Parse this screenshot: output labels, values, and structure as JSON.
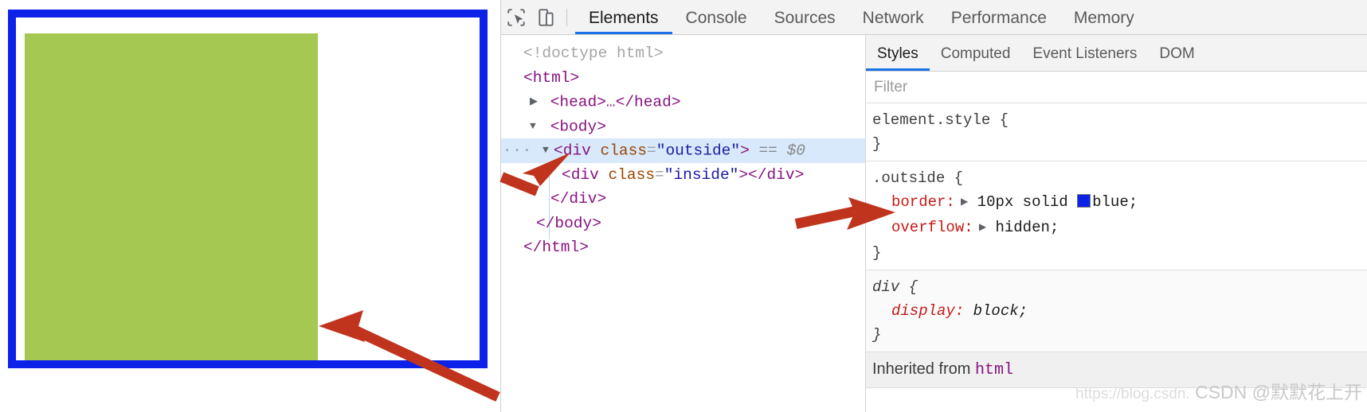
{
  "viewport": {
    "outside_box": {
      "name": "outside",
      "border_color": "#0d22e8",
      "border_width": "10px",
      "background": "#ffffff"
    },
    "inside_box": {
      "name": "inside",
      "background": "#a4c851"
    },
    "annotations": [
      {
        "name": "arrow-to-bottom-border",
        "color": "#c0341d"
      }
    ]
  },
  "devtools": {
    "toolbar": {
      "icons": [
        {
          "name": "inspect-element-icon",
          "glyph": "cursor-in-box"
        },
        {
          "name": "device-toolbar-icon",
          "glyph": "device-frame"
        }
      ],
      "tabs": [
        {
          "label": "Elements",
          "active": true
        },
        {
          "label": "Console",
          "active": false
        },
        {
          "label": "Sources",
          "active": false
        },
        {
          "label": "Network",
          "active": false
        },
        {
          "label": "Performance",
          "active": false
        },
        {
          "label": "Memory",
          "active": false
        }
      ]
    },
    "dom_tree": {
      "lines": [
        {
          "id": "doctype",
          "text": "<!doctype html>"
        },
        {
          "id": "html_open",
          "text": "<html>"
        },
        {
          "id": "head",
          "text": "<head>…</head>"
        },
        {
          "id": "body_open",
          "text": "<body>"
        },
        {
          "id": "div_outside",
          "tag": "div",
          "attr": "class",
          "value": "outside",
          "suffix": "== $0"
        },
        {
          "id": "div_inside",
          "tag": "div",
          "attr": "class",
          "value": "inside"
        },
        {
          "id": "div_close",
          "text": "</div>"
        },
        {
          "id": "body_close",
          "text": "</body>"
        },
        {
          "id": "html_close",
          "text": "</html>"
        }
      ],
      "selected_line": "div_outside",
      "ellipsis_badge": "···"
    },
    "styles": {
      "tabs": [
        {
          "label": "Styles",
          "active": true
        },
        {
          "label": "Computed",
          "active": false
        },
        {
          "label": "Event Listeners",
          "active": false
        },
        {
          "label": "DOM",
          "active": false
        }
      ],
      "filter_placeholder": "Filter",
      "filter_value": "",
      "rules": [
        {
          "selector": "element.style {",
          "close": "}",
          "declarations": []
        },
        {
          "selector": ".outside {",
          "close": "}",
          "declarations": [
            {
              "property": "border:",
              "value": "10px solid",
              "color_swatch": "#0d22e8",
              "color_name": "blue;",
              "expandable": true
            },
            {
              "property": "overflow:",
              "value": "hidden;",
              "expandable": true
            }
          ]
        },
        {
          "selector": "div {",
          "close": "}",
          "inherited_style": true,
          "declarations": [
            {
              "property": "display:",
              "value": "block;",
              "expandable": false
            }
          ]
        }
      ],
      "inherited_from_label": "Inherited from",
      "inherited_from_target": "html"
    }
  },
  "watermark": {
    "url": "https://blog.csdn.",
    "text": "CSDN @默默花上开"
  }
}
